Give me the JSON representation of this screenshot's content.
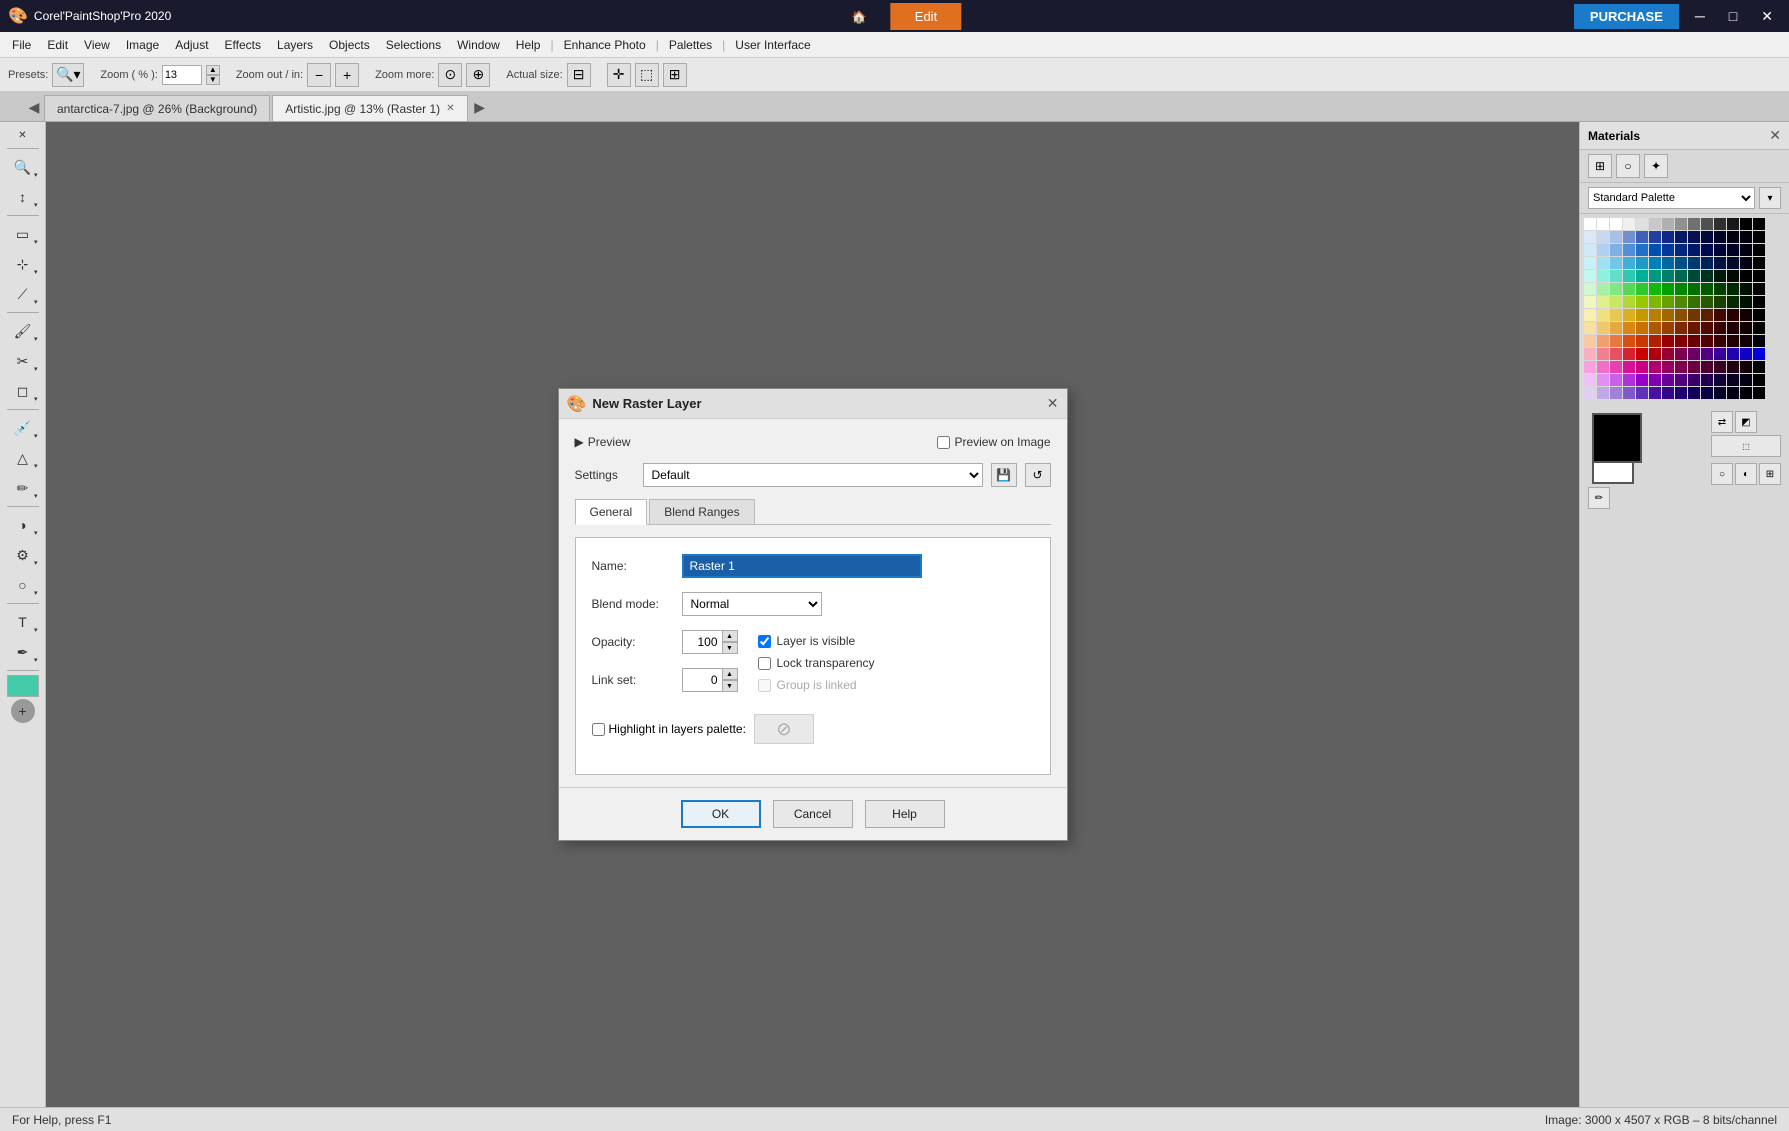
{
  "app": {
    "brand": "Corel'PaintShop'Pro 2020",
    "titlebar": {
      "nav_items": [
        "Home",
        "Edit"
      ],
      "active_nav": "Edit",
      "purchase_label": "PURCHASE",
      "window_controls": [
        "─",
        "□",
        "✕"
      ]
    }
  },
  "menubar": {
    "items": [
      "File",
      "Edit",
      "View",
      "Image",
      "Adjust",
      "Effects",
      "Layers",
      "Objects",
      "Selections",
      "Window",
      "Help",
      "Enhance Photo",
      "Palettes",
      "User Interface"
    ]
  },
  "toolbar": {
    "presets_label": "Presets:",
    "zoom_label": "Zoom ( % ):",
    "zoom_value": "13",
    "zoom_out_in_label": "Zoom out / in:",
    "zoom_more_label": "Zoom more:",
    "actual_size_label": "Actual size:"
  },
  "tabs": {
    "items": [
      {
        "label": "antarctica-7.jpg @ 26% (Background)",
        "active": false,
        "closeable": false
      },
      {
        "label": "Artistic.jpg @ 13% (Raster 1)",
        "active": true,
        "closeable": true
      }
    ]
  },
  "dialog": {
    "title": "New Raster Layer",
    "preview_label": "Preview",
    "preview_on_image_label": "Preview on Image",
    "settings_label": "Settings",
    "settings_default": "Default",
    "tabs": [
      "General",
      "Blend Ranges"
    ],
    "active_tab": "General",
    "form": {
      "name_label": "Name:",
      "name_value": "Raster 1",
      "blend_mode_label": "Blend mode:",
      "blend_mode_value": "Normal",
      "opacity_label": "Opacity:",
      "opacity_value": "100",
      "link_set_label": "Link set:",
      "link_set_value": "0",
      "layer_visible_label": "Layer is visible",
      "layer_visible_checked": true,
      "lock_transparency_label": "Lock transparency",
      "lock_transparency_checked": false,
      "group_is_linked_label": "Group is linked",
      "group_is_linked_checked": false,
      "group_is_linked_disabled": true,
      "highlight_label": "Highlight in layers palette:",
      "highlight_checked": false
    },
    "buttons": {
      "ok": "OK",
      "cancel": "Cancel",
      "help": "Help"
    }
  },
  "materials": {
    "title": "Materials",
    "palette_label": "Standard Palette",
    "icons": [
      "⊞",
      "○",
      "✦"
    ]
  },
  "statusbar": {
    "help_text": "For Help, press F1",
    "image_info": "Image:  3000 x 4507 x RGB – 8 bits/channel"
  },
  "colors": {
    "toolbar_bg": "#e8e8e8",
    "dialog_bg": "#f0f0f0",
    "tab_active_bg": "#f0f0f0",
    "accent_blue": "#1a7bca",
    "accent_orange": "#e07020"
  }
}
